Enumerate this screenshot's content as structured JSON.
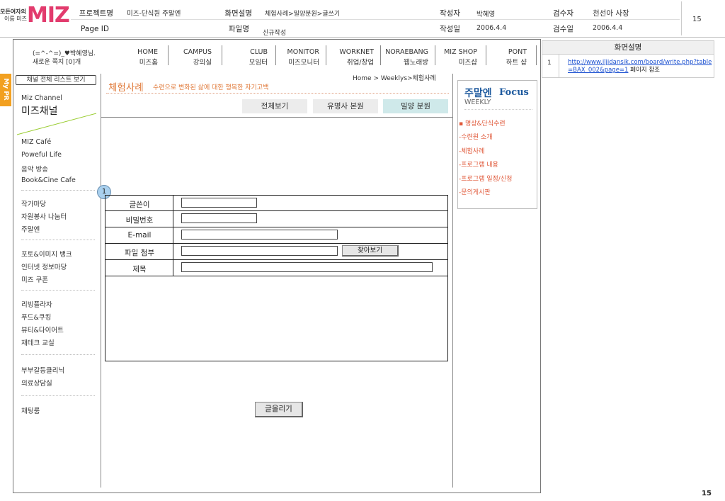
{
  "logo": {
    "tagline_line1": "모든여자의",
    "tagline_line2": "이름 미즈",
    "brand": "MIZ"
  },
  "meta": {
    "project_label": "프로젝트명",
    "project_value": "미즈-단식원 주말엔",
    "pageid_label": "Page ID",
    "screen_desc_label": "화면설명",
    "screen_desc_value": "체험사례>밀양분원>글쓰기",
    "filename_label": "파일명",
    "filename_value": "신규작성",
    "author_label": "작성자",
    "author_value": "박혜영",
    "date_label": "작성일",
    "date_value": "2006.4.4",
    "reviewer_label": "검수자",
    "reviewer_value": "천선아 사장",
    "review_date_label": "검수일",
    "review_date_value": "2006.4.4",
    "page_number": "15"
  },
  "user": {
    "greeting": "(=^-^=)_♥박혜영님.",
    "notes": "새로운 쪽지 [0]개"
  },
  "nav": [
    {
      "top": "HOME",
      "bottom": "미즈홈"
    },
    {
      "top": "CAMPUS",
      "bottom": "강의실"
    },
    {
      "top": "CLUB",
      "bottom": "모임터"
    },
    {
      "top": "MONITOR",
      "bottom": "미즈모니터"
    },
    {
      "top": "WORKNET",
      "bottom": "취업/창업"
    },
    {
      "top": "NORAEBANG",
      "bottom": "웹노래방"
    },
    {
      "top": "MIZ SHOP",
      "bottom": "미즈샵"
    },
    {
      "top": "PONT",
      "bottom": "하트 샵"
    }
  ],
  "mypr": "My PR",
  "left": {
    "channel_list_button": "채널 전체 리스트 보기",
    "channel_en": "Miz Channel",
    "channel_ko": "미즈채널",
    "group1": [
      "MIZ Café",
      "Poweful Life",
      "음악 방송",
      "Book&Cine Cafe"
    ],
    "group2": [
      "작가마당",
      "자원봉사 나눔터",
      "주말엔"
    ],
    "group3": [
      "포토&이미지 뱅크",
      "인터넷 정보마당",
      "미즈 쿠폰"
    ],
    "group4": [
      "리빙플라자",
      "푸드&쿠킹",
      "뷰티&다이어트",
      "재테크 교실"
    ],
    "group5": [
      "부부갈등클리닉",
      "의료상담실"
    ],
    "group6": [
      "채팅룸"
    ]
  },
  "content": {
    "breadcrumb": "Home > Weeklys>체험사례",
    "title": "체험사례",
    "subtitle": "수련으로 변화된 삶에 대한 행복한 자기고백",
    "tabs": [
      "전체보기",
      "유명사 본원",
      "밀양 분원"
    ],
    "marker": "1",
    "form": {
      "writer": "글쓴이",
      "password": "비밀번호",
      "email": "E-mail",
      "attach": "파일 첨부",
      "browse": "찾아보기",
      "subject": "제목"
    },
    "submit": "글올리기"
  },
  "focus": {
    "title_ko": "주말엔",
    "title_en": "Focus",
    "weekly": "WEEKLY",
    "items": [
      "▪ 명상&단식수련",
      "-수련원 소개",
      "-체험사례",
      "-프로그램 내용",
      "-프로그램 일정/신청",
      "-문의게시판"
    ]
  },
  "right_panel": {
    "title": "화면설명",
    "row_number": "1",
    "link": "http://www.iljidansik.com/board/write.php?table=BAX_002&page=1",
    "link_suffix": "페이지 참조"
  },
  "footer_page": "15"
}
